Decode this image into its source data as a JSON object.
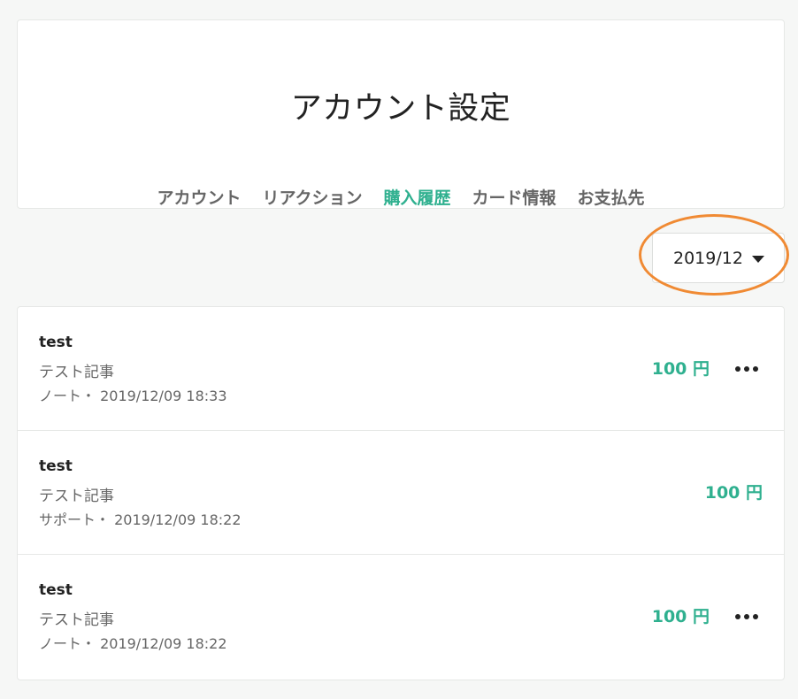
{
  "header": {
    "title": "アカウント設定",
    "tabs": [
      {
        "label": "アカウント",
        "active": false
      },
      {
        "label": "リアクション",
        "active": false
      },
      {
        "label": "購入履歴",
        "active": true
      },
      {
        "label": "カード情報",
        "active": false
      },
      {
        "label": "お支払先",
        "active": false
      }
    ]
  },
  "month_select": {
    "value": "2019/12"
  },
  "purchases": [
    {
      "title": "test",
      "subtitle": "テスト記事",
      "meta": "ノート・ 2019/12/09 18:33",
      "price": "100 円",
      "has_menu": true
    },
    {
      "title": "test",
      "subtitle": "テスト記事",
      "meta": "サポート・ 2019/12/09 18:22",
      "price": "100 円",
      "has_menu": false
    },
    {
      "title": "test",
      "subtitle": "テスト記事",
      "meta": "ノート・ 2019/12/09 18:22",
      "price": "100 円",
      "has_menu": true
    }
  ],
  "colors": {
    "accent": "#2fb08f",
    "highlight": "#f08a33",
    "background": "#f6f7f6",
    "text": "#222222",
    "muted": "#666666"
  },
  "icons": {
    "dropdown": "caret-down-icon",
    "more": "more-dots-icon"
  }
}
